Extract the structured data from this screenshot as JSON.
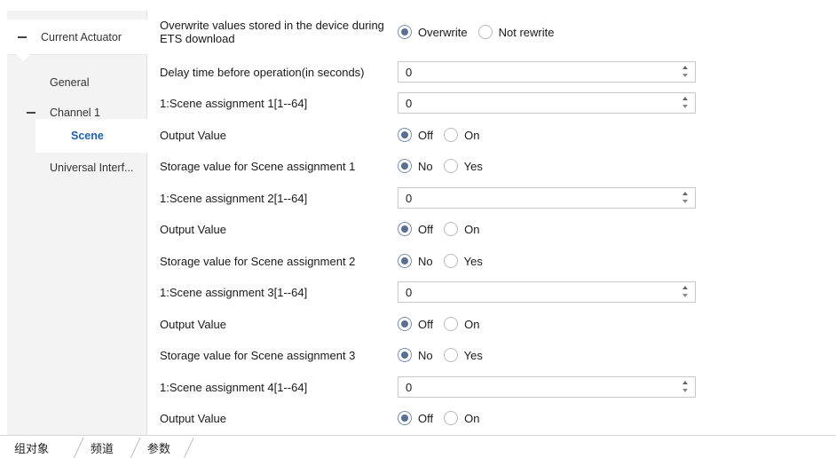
{
  "sidebar": {
    "root_label": "Current Actuator",
    "items": [
      {
        "label": "General"
      },
      {
        "label": "Channel 1"
      },
      {
        "label": "Scene"
      },
      {
        "label": "Universal Interf..."
      }
    ]
  },
  "params": {
    "r0": {
      "label": "Overwrite values stored in the device during ETS download",
      "opt1": "Overwrite",
      "opt2": "Not rewrite"
    },
    "r1": {
      "label": "Delay time before operation(in seconds)",
      "value": "0"
    },
    "r2": {
      "label": "1:Scene assignment 1[1--64]",
      "value": "0"
    },
    "r3": {
      "label": "Output Value",
      "opt1": "Off",
      "opt2": "On"
    },
    "r4": {
      "label": "Storage value for Scene assignment 1",
      "opt1": "No",
      "opt2": "Yes"
    },
    "r5": {
      "label": "1:Scene assignment 2[1--64]",
      "value": "0"
    },
    "r6": {
      "label": "Output Value",
      "opt1": "Off",
      "opt2": "On"
    },
    "r7": {
      "label": "Storage value for Scene assignment 2",
      "opt1": "No",
      "opt2": "Yes"
    },
    "r8": {
      "label": "1:Scene assignment 3[1--64]",
      "value": "0"
    },
    "r9": {
      "label": "Output Value",
      "opt1": "Off",
      "opt2": "On"
    },
    "r10": {
      "label": "Storage value for Scene assignment 3",
      "opt1": "No",
      "opt2": "Yes"
    },
    "r11": {
      "label": "1:Scene assignment 4[1--64]",
      "value": "0"
    },
    "r12": {
      "label": "Output Value",
      "opt1": "Off",
      "opt2": "On"
    }
  },
  "tabs": [
    {
      "label": "组对象"
    },
    {
      "label": "频道"
    },
    {
      "label": "参数"
    }
  ],
  "colors": {
    "selected_item": "#1f5fa8",
    "radio_checked": "#5b6f92"
  }
}
